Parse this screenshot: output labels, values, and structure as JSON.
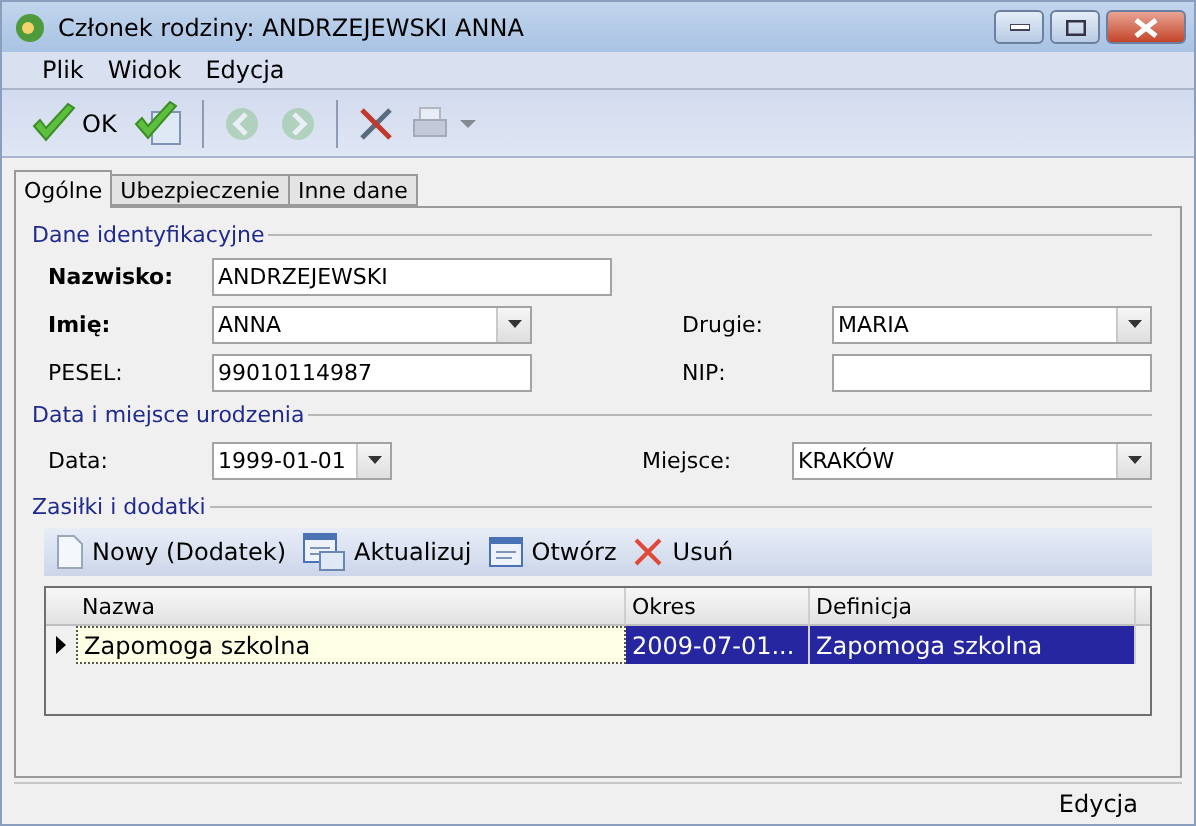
{
  "window": {
    "title": "Członek rodziny: ANDRZEJEWSKI ANNA"
  },
  "menu": [
    "Plik",
    "Widok",
    "Edycja"
  ],
  "toolbar": [
    {
      "kind": "ok",
      "label": "OK",
      "disabled": false
    },
    {
      "kind": "save",
      "disabled": false
    },
    {
      "kind": "separator"
    },
    {
      "kind": "back",
      "disabled": true
    },
    {
      "kind": "forward",
      "disabled": true
    },
    {
      "kind": "separator"
    },
    {
      "kind": "tools",
      "disabled": false
    },
    {
      "kind": "print",
      "disabled": true
    }
  ],
  "tabs": [
    {
      "label": "Ogólne",
      "selected": true
    },
    {
      "label": "Ubezpieczenie",
      "selected": false
    },
    {
      "label": "Inne dane",
      "selected": false
    }
  ],
  "sections": [
    {
      "title": "Dane identyfikacyjne",
      "rows": [
        [
          {
            "label": "Nazwisko:",
            "required": true,
            "value": "ANDRZEJEWSKI",
            "kind": "text"
          }
        ],
        [
          {
            "label": "Imię:",
            "required": true,
            "value": "ANNA",
            "kind": "combo"
          },
          {
            "label": "Drugie:",
            "required": false,
            "value": "MARIA",
            "kind": "combo"
          }
        ],
        [
          {
            "label": "PESEL:",
            "required": false,
            "value": "99010114987",
            "kind": "text"
          },
          {
            "label": "NIP:",
            "required": false,
            "kind": "text"
          }
        ]
      ]
    },
    {
      "title": "Data i miejsce urodzenia",
      "rows": [
        [
          {
            "label": "Data:",
            "required": false,
            "value": "1999-01-01",
            "kind": "combo"
          },
          {
            "label": "Miejsce:",
            "required": false,
            "value": "KRAKÓW",
            "kind": "combo"
          }
        ]
      ]
    }
  ],
  "benefits": {
    "title": "Zasiłki i dodatki",
    "actions": [
      {
        "kind": "new",
        "label": "Nowy (Dodatek)"
      },
      {
        "kind": "update",
        "label": "Aktualizuj"
      },
      {
        "kind": "open",
        "label": "Otwórz"
      },
      {
        "kind": "delete",
        "label": "Usuń"
      }
    ],
    "columns": [
      "Nazwa",
      "Okres",
      "Definicja"
    ],
    "rows": [
      {
        "selected": true,
        "cells": [
          {
            "text": "Zapomoga szkolna",
            "focused": true
          },
          {
            "text": "2009-07-01...",
            "focused": false
          },
          {
            "text": "Zapomoga szkolna",
            "focused": false
          }
        ]
      }
    ]
  },
  "status_bar": {
    "mode": "Edycja"
  }
}
